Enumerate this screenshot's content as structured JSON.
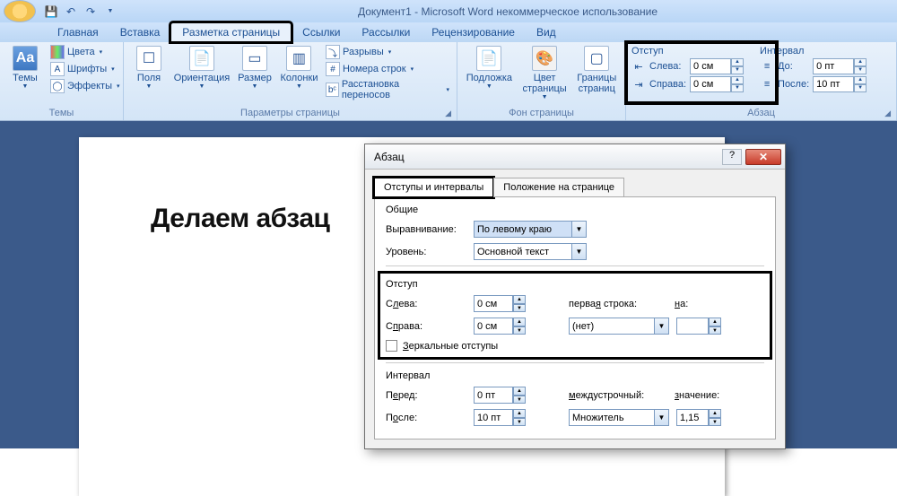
{
  "title": "Документ1 - Microsoft Word некоммерческое использование",
  "tabs": [
    "Главная",
    "Вставка",
    "Разметка страницы",
    "Ссылки",
    "Рассылки",
    "Рецензирование",
    "Вид"
  ],
  "active_tab": 2,
  "ribbon": {
    "themes": {
      "label": "Темы",
      "btn": "Темы",
      "colors": "Цвета",
      "fonts": "Шрифты",
      "effects": "Эффекты"
    },
    "page_setup": {
      "label": "Параметры страницы",
      "margins": "Поля",
      "orientation": "Ориентация",
      "size": "Размер",
      "columns": "Колонки",
      "breaks": "Разрывы",
      "line_numbers": "Номера строк",
      "hyphenation": "Расстановка переносов"
    },
    "page_bg": {
      "label": "Фон страницы",
      "watermark": "Подложка",
      "color": "Цвет\nстраницы",
      "borders": "Границы\nстраниц"
    },
    "paragraph": {
      "label": "Абзац",
      "indent_hdr": "Отступ",
      "spacing_hdr": "Интервал",
      "left": "Слева:",
      "right": "Справа:",
      "before": "До:",
      "after": "После:",
      "left_val": "0 см",
      "right_val": "0 см",
      "before_val": "0 пт",
      "after_val": "10 пт"
    }
  },
  "document": {
    "heading": "Делаем абзац"
  },
  "dialog": {
    "title": "Абзац",
    "tab1": "Отступы и интервалы",
    "tab2": "Положение на странице",
    "general": "Общие",
    "alignment_lbl": "Выравнивание:",
    "alignment_val": "По левому краю",
    "level_lbl": "Уровень:",
    "level_val": "Основной текст",
    "indent": "Отступ",
    "left_lbl": "Слева:",
    "left_val": "0 см",
    "right_lbl": "Справа:",
    "right_val": "0 см",
    "firstline_lbl": "первая строка:",
    "firstline_val": "(нет)",
    "by_lbl": "на:",
    "by_val": "",
    "mirror": "Зеркальные отступы",
    "spacing": "Интервал",
    "before_lbl": "Перед:",
    "before_val": "0 пт",
    "after_lbl": "После:",
    "after_val": "10 пт",
    "linesp_lbl": "междустрочный:",
    "linesp_val": "Множитель",
    "at_lbl": "значение:",
    "at_val": "1,15"
  }
}
